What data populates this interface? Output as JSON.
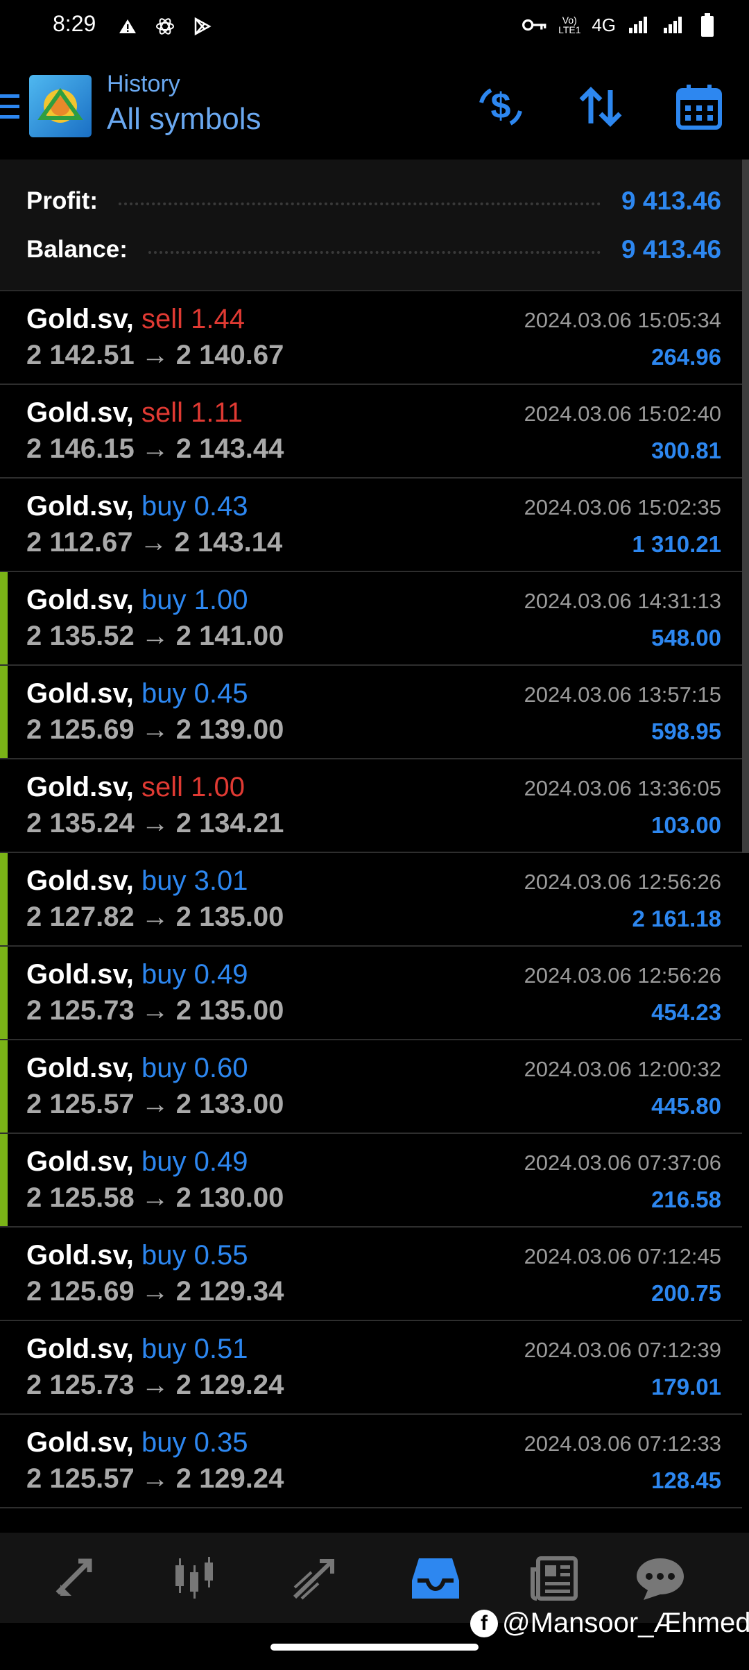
{
  "status_bar": {
    "time": "8:29",
    "network": "4G"
  },
  "header": {
    "subtitle": "History",
    "title": "All symbols"
  },
  "summary": {
    "profit_label": "Profit:",
    "profit_value": "9 413.46",
    "balance_label": "Balance:",
    "balance_value": "9 413.46"
  },
  "deals": [
    {
      "symbol": "Gold.sv,",
      "type": "sell",
      "volume": "1.44",
      "open": "2 142.51",
      "close": "2 140.67",
      "time": "2024.03.06 15:05:34",
      "profit": "264.96",
      "marked": false
    },
    {
      "symbol": "Gold.sv,",
      "type": "sell",
      "volume": "1.11",
      "open": "2 146.15",
      "close": "2 143.44",
      "time": "2024.03.06 15:02:40",
      "profit": "300.81",
      "marked": false
    },
    {
      "symbol": "Gold.sv,",
      "type": "buy",
      "volume": "0.43",
      "open": "2 112.67",
      "close": "2 143.14",
      "time": "2024.03.06 15:02:35",
      "profit": "1 310.21",
      "marked": false
    },
    {
      "symbol": "Gold.sv,",
      "type": "buy",
      "volume": "1.00",
      "open": "2 135.52",
      "close": "2 141.00",
      "time": "2024.03.06 14:31:13",
      "profit": "548.00",
      "marked": true
    },
    {
      "symbol": "Gold.sv,",
      "type": "buy",
      "volume": "0.45",
      "open": "2 125.69",
      "close": "2 139.00",
      "time": "2024.03.06 13:57:15",
      "profit": "598.95",
      "marked": true
    },
    {
      "symbol": "Gold.sv,",
      "type": "sell",
      "volume": "1.00",
      "open": "2 135.24",
      "close": "2 134.21",
      "time": "2024.03.06 13:36:05",
      "profit": "103.00",
      "marked": false
    },
    {
      "symbol": "Gold.sv,",
      "type": "buy",
      "volume": "3.01",
      "open": "2 127.82",
      "close": "2 135.00",
      "time": "2024.03.06 12:56:26",
      "profit": "2 161.18",
      "marked": true
    },
    {
      "symbol": "Gold.sv,",
      "type": "buy",
      "volume": "0.49",
      "open": "2 125.73",
      "close": "2 135.00",
      "time": "2024.03.06 12:56:26",
      "profit": "454.23",
      "marked": true
    },
    {
      "symbol": "Gold.sv,",
      "type": "buy",
      "volume": "0.60",
      "open": "2 125.57",
      "close": "2 133.00",
      "time": "2024.03.06 12:00:32",
      "profit": "445.80",
      "marked": true
    },
    {
      "symbol": "Gold.sv,",
      "type": "buy",
      "volume": "0.49",
      "open": "2 125.58",
      "close": "2 130.00",
      "time": "2024.03.06 07:37:06",
      "profit": "216.58",
      "marked": true
    },
    {
      "symbol": "Gold.sv,",
      "type": "buy",
      "volume": "0.55",
      "open": "2 125.69",
      "close": "2 129.34",
      "time": "2024.03.06 07:12:45",
      "profit": "200.75",
      "marked": false
    },
    {
      "symbol": "Gold.sv,",
      "type": "buy",
      "volume": "0.51",
      "open": "2 125.73",
      "close": "2 129.24",
      "time": "2024.03.06 07:12:39",
      "profit": "179.01",
      "marked": false
    },
    {
      "symbol": "Gold.sv,",
      "type": "buy",
      "volume": "0.35",
      "open": "2 125.57",
      "close": "2 129.24",
      "time": "2024.03.06 07:12:33",
      "profit": "128.45",
      "marked": false
    }
  ],
  "nav": [
    {
      "name": "quotes-icon",
      "active": false
    },
    {
      "name": "chart-icon",
      "active": false
    },
    {
      "name": "trade-icon",
      "active": false
    },
    {
      "name": "history-icon",
      "active": true
    },
    {
      "name": "news-icon",
      "active": false
    },
    {
      "name": "messages-icon",
      "active": false
    }
  ],
  "watermark": "@Mansoor_Æhmed",
  "colors": {
    "accent": "#2d87f0",
    "sell": "#e03a33",
    "marker": "#7ab317",
    "background": "#000000"
  }
}
